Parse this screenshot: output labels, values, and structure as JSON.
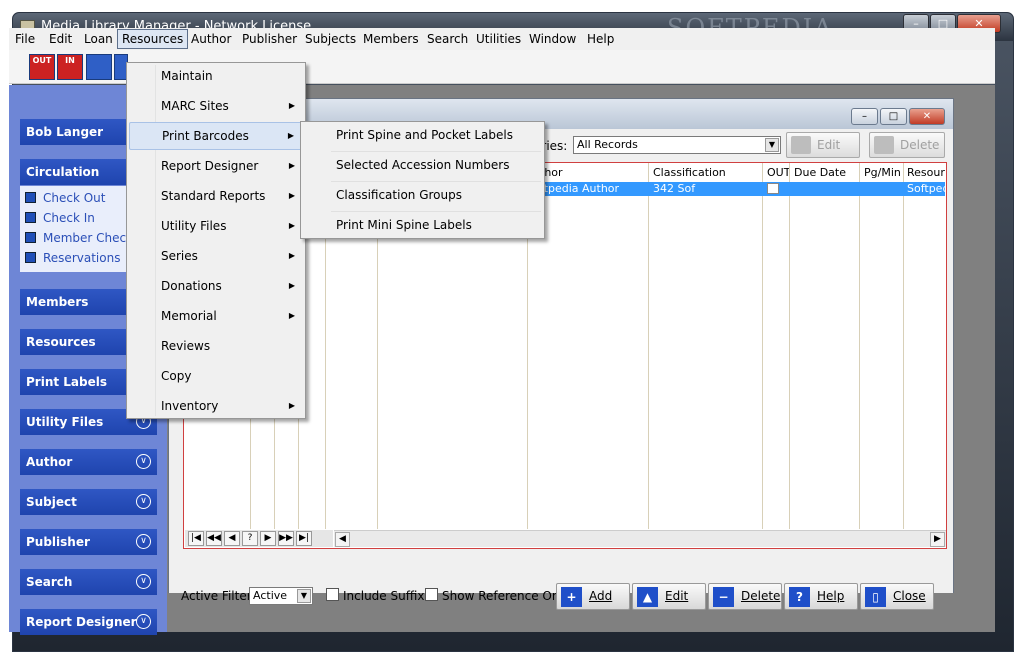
{
  "window": {
    "title": "Media Library Manager - Network License",
    "watermark": "SOFTPEDIA",
    "min": "–",
    "max": "□",
    "close": "✕"
  },
  "menubar": [
    "File",
    "Edit",
    "Loan",
    "Resources",
    "Author",
    "Publisher",
    "Subjects",
    "Members",
    "Search",
    "Utilities",
    "Window",
    "Help"
  ],
  "toolbar": [
    {
      "name": "out-icon",
      "label": "OUT"
    },
    {
      "name": "in-icon",
      "label": "IN"
    },
    {
      "name": "book-icon",
      "label": ""
    },
    {
      "name": "book2-icon",
      "label": ""
    }
  ],
  "sidebar": {
    "user": "Bob Langer",
    "circulation": "Circulation",
    "circ_items": [
      "Check Out",
      "Check In",
      "Member Check",
      "Reservations"
    ],
    "groups": [
      "Members",
      "Resources",
      "Print Labels",
      "Utility Files",
      "Author",
      "Subject",
      "Publisher",
      "Search",
      "Report Designer"
    ]
  },
  "resources_menu": [
    "Maintain",
    "MARC Sites",
    "Print Barcodes",
    "Report Designer",
    "Standard Reports",
    "Utility Files",
    "Series",
    "Donations",
    "Memorial",
    "Reviews",
    "Copy",
    "Inventory"
  ],
  "print_barcodes_submenu": [
    "Print Spine and Pocket Labels",
    "Selected Accession Numbers",
    "Classification Groups",
    "Print Mini Spine Labels"
  ],
  "child": {
    "series_label": "eries:",
    "series_value": "All Records",
    "edit_top": "Edit",
    "delete_top": "Delete",
    "columns": [
      "thor",
      "Classification",
      "OUT",
      "Due Date",
      "Pg/Min",
      "Resour"
    ],
    "row": {
      "author": "ftpedia Author",
      "classification": "342 Sof",
      "resource": "Softped"
    },
    "nav": [
      "|◀",
      "◀◀",
      "◀",
      "?",
      "▶",
      "▶▶",
      "▶|"
    ],
    "active_filter_label": "Active Filter:",
    "active_filter_value": "Active",
    "include_suffix": "Include Suffix",
    "show_reference": "Show Reference Only",
    "buttons": {
      "add": "Add",
      "edit": "Edit",
      "delete": "Delete",
      "help": "Help",
      "close": "Close"
    }
  },
  "colors": {
    "selection": "#3399ff",
    "sidebar": "#6e86d6",
    "sidebar_button": "#2f57c4"
  }
}
